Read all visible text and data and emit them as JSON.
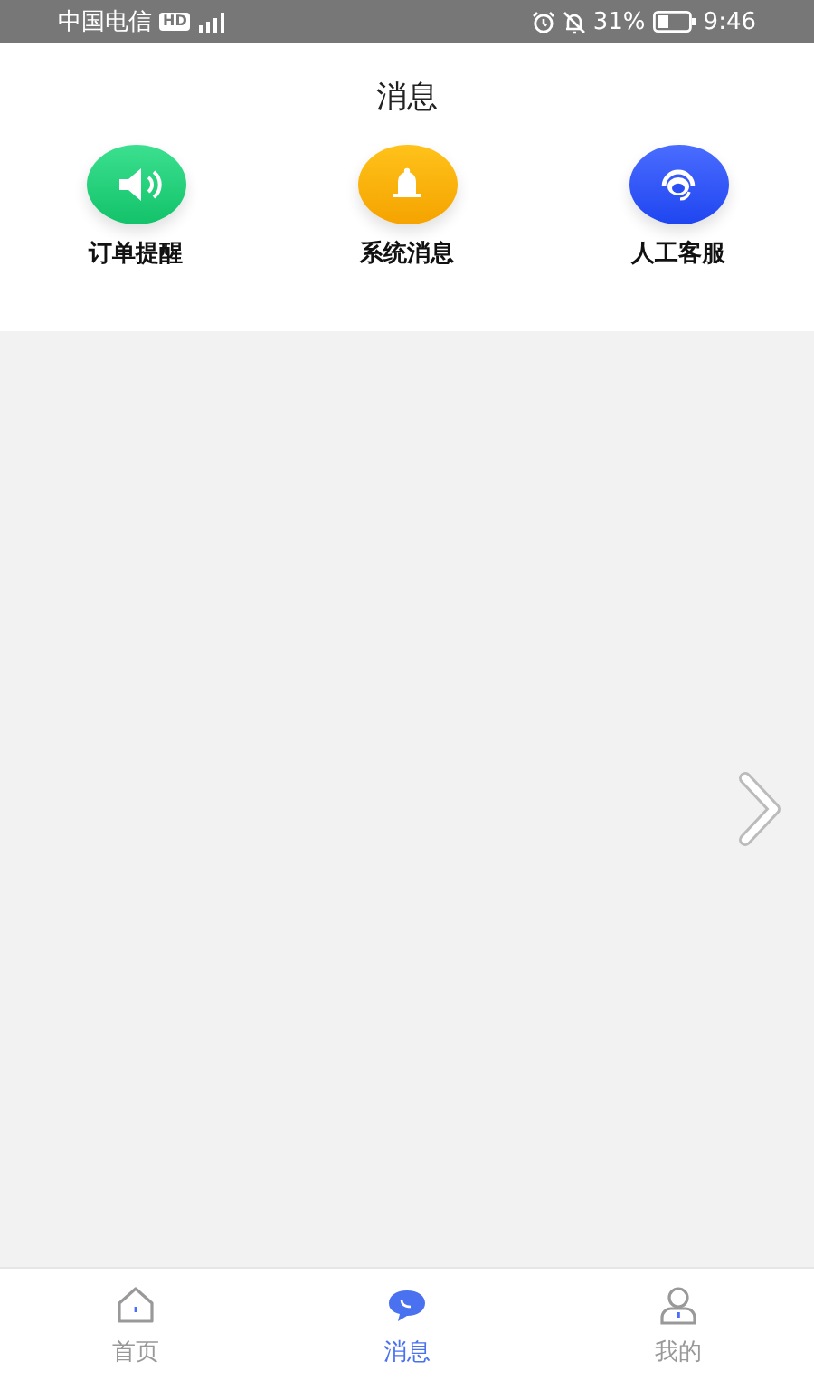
{
  "status_bar": {
    "carrier": "中国电信",
    "hd": "HD",
    "battery": "31%",
    "time": "9:46"
  },
  "header": {
    "title": "消息"
  },
  "entries": [
    {
      "label": "订单提醒",
      "kind": "speaker"
    },
    {
      "label": "系统消息",
      "kind": "bell"
    },
    {
      "label": "人工客服",
      "kind": "service"
    }
  ],
  "tabs": [
    {
      "label": "首页",
      "kind": "home",
      "selected": false
    },
    {
      "label": "消息",
      "kind": "message",
      "selected": true
    },
    {
      "label": "我的",
      "kind": "profile",
      "selected": false
    }
  ]
}
